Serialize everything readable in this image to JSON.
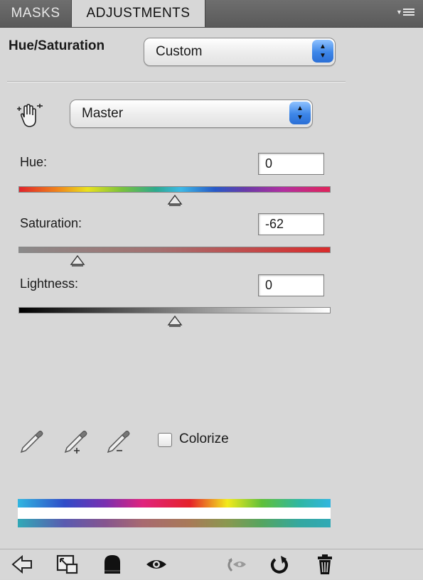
{
  "tabs": {
    "masks": "MASKS",
    "adjustments": "ADJUSTMENTS"
  },
  "panel_menu_icon": "panel-menu-icon",
  "adjustment": {
    "title": "Hue/Saturation",
    "preset": "Custom",
    "channel": "Master"
  },
  "sliders": {
    "hue": {
      "label": "Hue:",
      "value": "0",
      "level": 0.5
    },
    "saturation": {
      "label": "Saturation:",
      "value": "-62",
      "level": 0.19
    },
    "lightness": {
      "label": "Lightness:",
      "value": "0",
      "level": 0.5
    }
  },
  "colorize": {
    "label": "Colorize",
    "checked": false
  },
  "icons": {
    "hand": "targeted-adjustment-icon",
    "eyedropper": "eyedropper-icon",
    "eyedropper_add": "eyedropper-add-icon",
    "eyedropper_subtract": "eyedropper-subtract-icon",
    "back": "back-arrow-icon",
    "expand": "expand-view-icon",
    "clip": "clip-to-layer-icon",
    "visibility": "eye-icon",
    "previous_state": "previous-state-icon",
    "reset": "reset-icon",
    "delete": "trash-icon"
  }
}
